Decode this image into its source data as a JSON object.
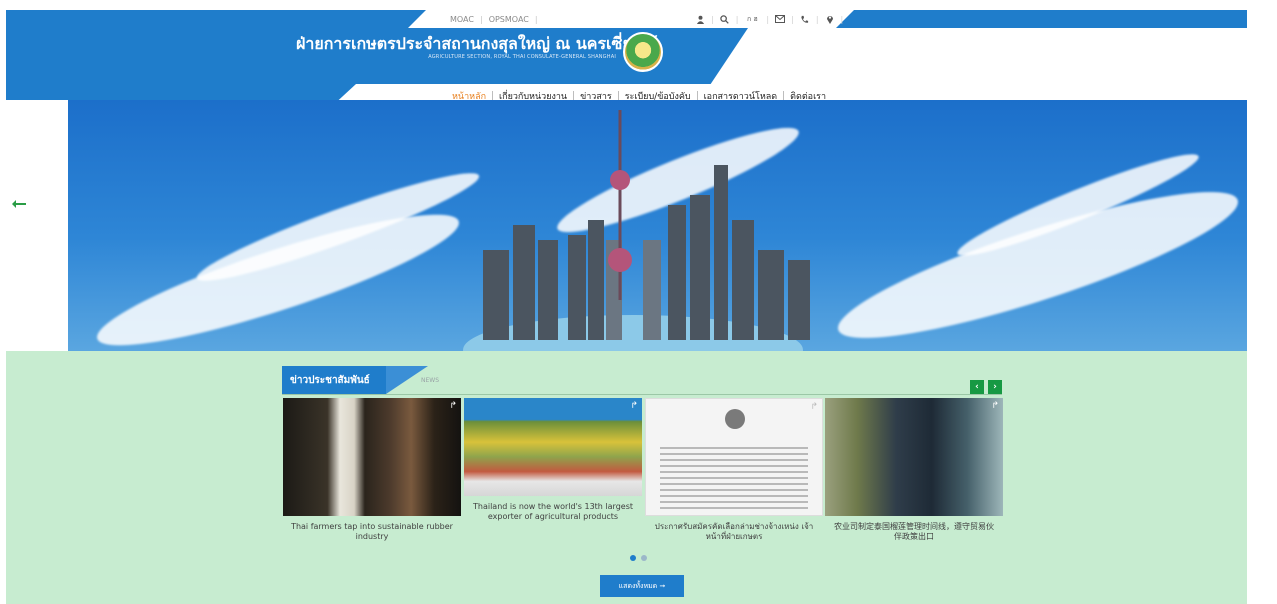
{
  "utility": {
    "links": [
      "MOAC",
      "OPSMOAC"
    ],
    "icons": [
      "user-icon",
      "search-icon",
      "language-icon",
      "mail-icon",
      "phone-icon",
      "location-icon"
    ],
    "language_label": "ก ฮ"
  },
  "header": {
    "title": "ฝ่ายการเกษตรประจำสถานกงสุลใหญ่ ณ นครเซี่ยงไฮ้",
    "subtitle": "AGRICULTURE SECTION, ROYAL THAI CONSULATE-GENERAL SHANGHAI"
  },
  "nav": {
    "items": [
      "หน้าหลัก",
      "เกี่ยวกับหน่วยงาน",
      "ข่าวสาร",
      "ระเบียบ/ข้อบังคับ",
      "เอกสารดาวน์โหลด",
      "ติดต่อเรา"
    ],
    "active_index": 0
  },
  "news": {
    "heading": "ข่าวประชาสัมพันธ์",
    "subheading": "NEWS",
    "cards": [
      {
        "caption": "Thai farmers tap into sustainable rubber industry",
        "image": "rubber-farmer-image"
      },
      {
        "caption": "Thailand is now the world's 13th largest exporter of agricultural products",
        "image": "durian-fruits-image"
      },
      {
        "caption": "ประกาศรับสมัครคัดเลือกล่ามช่างจ้างเหน่ง เจ้าหน้าที่ฝ่ายเกษตร",
        "image": "announcement-document-image"
      },
      {
        "caption": "农业司制定泰国榴莲管理时间线，遵守贸易伙伴政策出口",
        "image": "officer-holding-durian-image"
      }
    ],
    "pager": {
      "total": 2,
      "active": 0
    },
    "show_all_label": "แสดงทั้งหมด ➞"
  },
  "colors": {
    "brand_blue": "#1f7dcb",
    "active_nav": "#e8801f",
    "section_bg": "#c7ecd0",
    "nav_button_green": "#179943"
  }
}
